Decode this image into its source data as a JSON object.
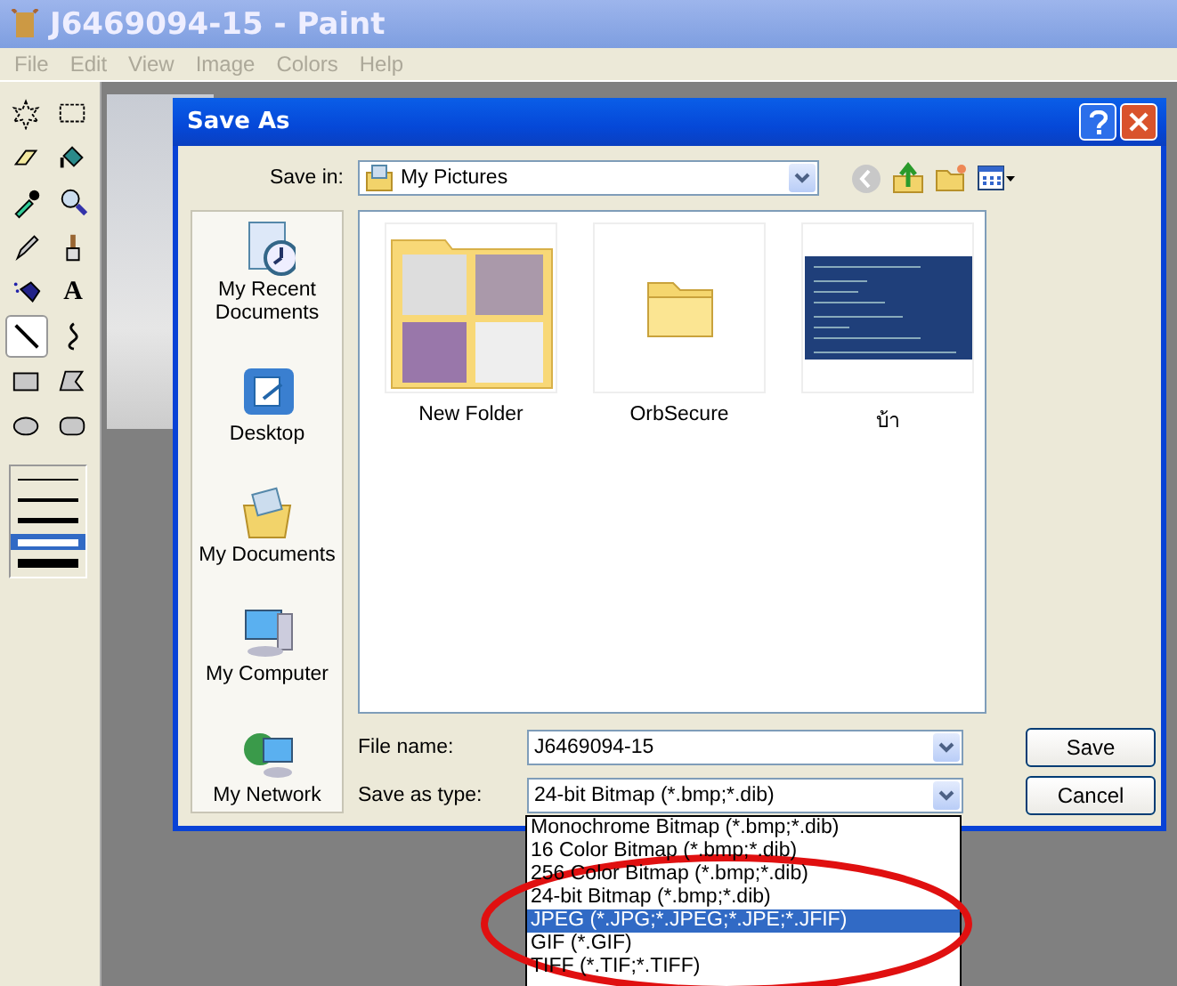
{
  "window": {
    "title": "J6469094-15 - Paint"
  },
  "menu": [
    {
      "label": "File",
      "disabled": true
    },
    {
      "label": "Edit",
      "disabled": true
    },
    {
      "label": "View",
      "disabled": true
    },
    {
      "label": "Image",
      "disabled": true
    },
    {
      "label": "Colors",
      "disabled": true
    },
    {
      "label": "Help",
      "disabled": true
    }
  ],
  "tools": [
    {
      "kind": "free-select",
      "selected": false
    },
    {
      "kind": "rect-select",
      "selected": false
    },
    {
      "kind": "eraser",
      "selected": false
    },
    {
      "kind": "fill",
      "selected": false
    },
    {
      "kind": "picker",
      "selected": false
    },
    {
      "kind": "magnifier",
      "selected": false
    },
    {
      "kind": "pencil",
      "selected": false
    },
    {
      "kind": "brush",
      "selected": false
    },
    {
      "kind": "airbrush",
      "selected": false
    },
    {
      "kind": "text",
      "glyph": "A",
      "selected": false
    },
    {
      "kind": "line",
      "selected": true
    },
    {
      "kind": "curve",
      "selected": false
    },
    {
      "kind": "rectangle",
      "selected": false
    },
    {
      "kind": "polygon",
      "selected": false
    },
    {
      "kind": "ellipse",
      "selected": false
    },
    {
      "kind": "rounded-rect",
      "selected": false
    }
  ],
  "line_widths": [
    {
      "selected": false
    },
    {
      "selected": false
    },
    {
      "selected": false
    },
    {
      "selected": true
    },
    {
      "selected": false
    }
  ],
  "dialog": {
    "title": "Save As",
    "save_in": {
      "label": "Save in:",
      "value": "My Pictures"
    },
    "places": [
      {
        "kind": "recent",
        "label": "My Recent Documents"
      },
      {
        "kind": "desktop",
        "label": "Desktop"
      },
      {
        "kind": "documents",
        "label": "My Documents"
      },
      {
        "kind": "computer",
        "label": "My Computer"
      },
      {
        "kind": "network",
        "label": "My Network"
      }
    ],
    "files": [
      {
        "kind": "thumb-folder",
        "name": "New Folder"
      },
      {
        "kind": "folder",
        "name": "OrbSecure"
      },
      {
        "kind": "image",
        "name": "บ้า"
      }
    ],
    "file_name": {
      "label": "File name:",
      "value": "J6469094-15"
    },
    "save_as_type": {
      "label": "Save as type:",
      "value": "24-bit Bitmap (*.bmp;*.dib)"
    },
    "buttons": [
      "Save",
      "Cancel"
    ],
    "type_options": [
      {
        "label": "Monochrome Bitmap (*.bmp;*.dib)",
        "selected": false
      },
      {
        "label": "16 Color Bitmap (*.bmp;*.dib)",
        "selected": false
      },
      {
        "label": "256 Color Bitmap (*.bmp;*.dib)",
        "selected": false
      },
      {
        "label": "24-bit Bitmap (*.bmp;*.dib)",
        "selected": false
      },
      {
        "label": "JPEG (*.JPG;*.JPEG;*.JPE;*.JFIF)",
        "selected": true
      },
      {
        "label": "GIF (*.GIF)",
        "selected": false
      },
      {
        "label": "TIFF (*.TIF;*.TIFF)",
        "selected": false
      }
    ]
  }
}
